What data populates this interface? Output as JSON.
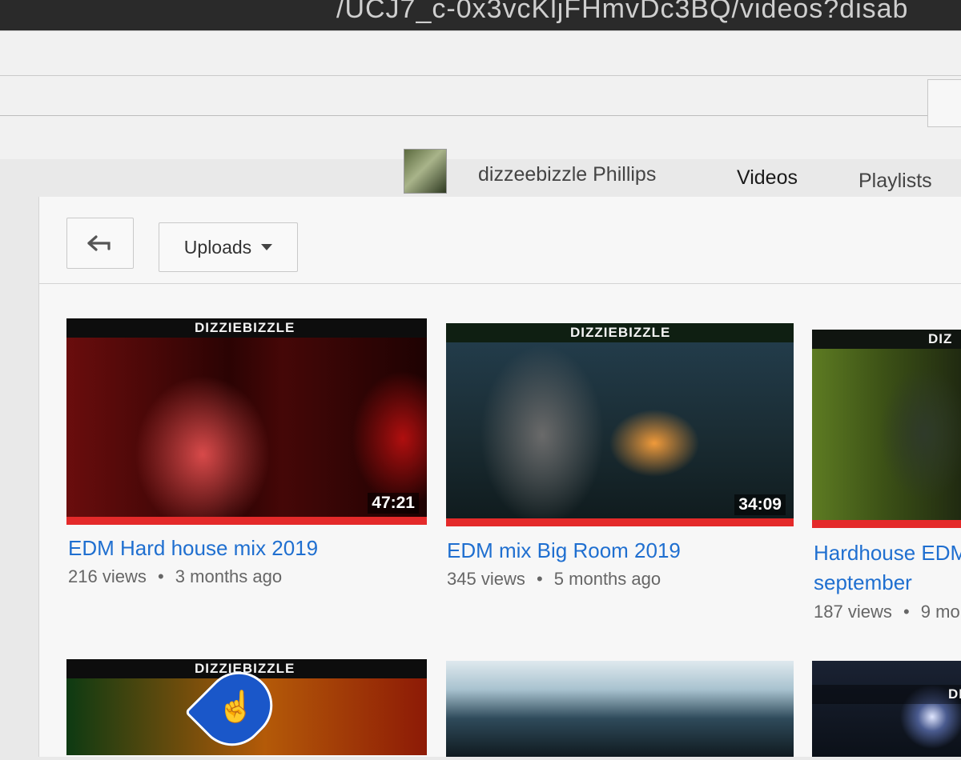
{
  "browser": {
    "url_fragment": "/UCJ7_c-0x3vcKljFHmvDc3BQ/videos?disab"
  },
  "channel": {
    "name": "dizzeebizzle Phillips"
  },
  "tabs": [
    {
      "label": "Videos",
      "active": true
    },
    {
      "label": "Playlists",
      "active": false
    }
  ],
  "toolbar": {
    "uploads_label": "Uploads"
  },
  "videos": [
    {
      "brand": "DIZZIEBIZZLE",
      "duration": "47:21",
      "title": "EDM Hard house mix 2019",
      "views": "216 views",
      "age": "3 months ago"
    },
    {
      "brand": "DIZZIEBIZZLE",
      "duration": "34:09",
      "title": "EDM mix Big Room 2019",
      "views": "345 views",
      "age": "5 months ago"
    },
    {
      "brand": "DIZ",
      "title_line1": "Hardhouse EDM",
      "title_line2": "september",
      "views": "187 views",
      "age": "9 mo"
    },
    {
      "brand": "DIZZIEBIZZLE"
    },
    {
      "brand": ""
    },
    {
      "brand": "DIZ"
    }
  ],
  "colors": {
    "accent": "#e02424",
    "link": "#1f6fd0",
    "meta": "#666666"
  },
  "meta_separator": "•"
}
